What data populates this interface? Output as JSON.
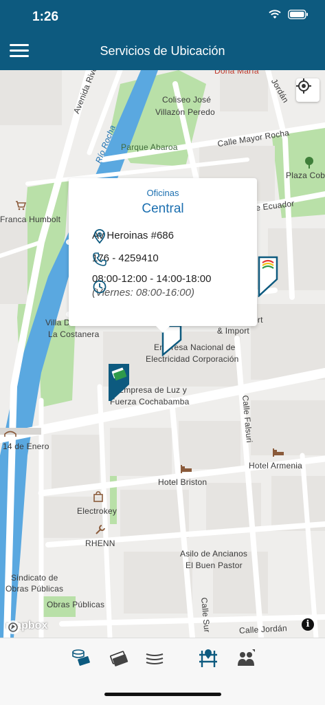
{
  "status_bar": {
    "time": "1:26"
  },
  "nav_bar": {
    "title": "Servicios de Ubicación"
  },
  "map": {
    "labels": {
      "dona_maria": "Doña María",
      "avenida_rivero": "Avenida Rivero",
      "coliseo": "Coliseo José",
      "coliseo2": "Villazón Peredo",
      "calle_mayor_rocha": "Calle Mayor Rocha",
      "parque_abaroa": "Parque Abaroa",
      "rio_rocha": "Río Rocha",
      "plaza_colon": "Plaza Cob",
      "franca_humbolt": "Franca Humbolt",
      "ecuador": "e Ecuador",
      "villa": "Villa D",
      "la_costanera": "La Costanera",
      "ort": "ort",
      "import": "& Import",
      "empresa_nacional": "Empresa Nacional de",
      "electricidad": "Electricidad Corporación",
      "empresa_luz": "Empresa de Luz y",
      "fuerza": "Fuerza Cochabamba",
      "calle_falsuri": "Calle Falsuri",
      "catorce_enero": "14 de Enero",
      "hotel_armenia": "Hotel Armenia",
      "hotel_briston": "Hotel Briston",
      "electrokey": "Electrokey",
      "rhenn": "RHENN",
      "asilo": "Asilo de Ancianos",
      "buen_pastor": "El Buen Pastor",
      "sindicato": "Sindicato de",
      "obras_publicas": "Obras Públicas",
      "obras_publicas2": "Obras Públicas",
      "calle_sur": "Calle Sur",
      "calle_jordan": "Calle Jordán",
      "jordan_top": "Jordán"
    },
    "attribution": "mapbox",
    "info": "i"
  },
  "popup": {
    "category": "Oficinas",
    "title": "Central",
    "address": "Av Heroinas #686",
    "phone": "176 - 4259410",
    "hours": "08:00-12:00 - 14:00-18:00",
    "hours_note": "(Viernes: 08:00-16:00)"
  },
  "colors": {
    "brand": "#0d5a7f",
    "accent": "#1b6fb0",
    "park": "#a9d89a",
    "river": "#5aa8e0"
  }
}
